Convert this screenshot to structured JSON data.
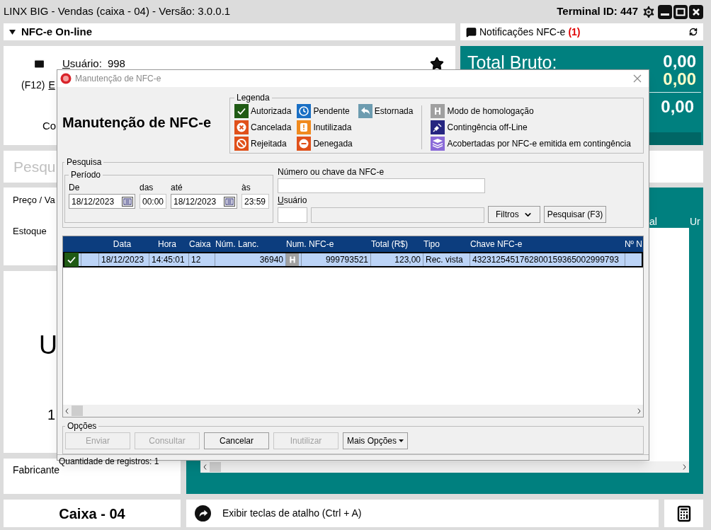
{
  "window": {
    "title": "LINX BIG - Vendas (caixa - 04) - Versão: 3.0.0.1",
    "terminal": "Terminal ID: 447"
  },
  "nfce_panel": {
    "title": "NFC-e On-line",
    "expanded": true,
    "user_label": "Usuário:",
    "user_value": "998",
    "shortcut": "(F12)",
    "link": "E",
    "text_3": "Co"
  },
  "notifications": {
    "label": "Notificações NFC-e",
    "count": "(1)"
  },
  "totals": {
    "label": "Total Bruto:",
    "values": [
      {
        "kind": "gross",
        "value": "0,00"
      },
      {
        "kind": "discount",
        "value": "0,00"
      },
      {
        "kind": "net",
        "value": "0,00"
      }
    ]
  },
  "search": {
    "placeholder": "Pesqu"
  },
  "product_fields": [
    "Preço / Va",
    "Estoque"
  ],
  "product_display": {
    "unit": "U",
    "quantity": "1"
  },
  "manufacturer": "Fabricante",
  "items_table": {
    "columns": [
      "al",
      "Ur"
    ]
  },
  "footer": {
    "register": "Caixa - 04",
    "shortcut": "Exibir teclas de atalho (Ctrl + A)"
  },
  "dialog": {
    "title": "Manutenção de NFC-e",
    "heading": "Manutenção de NFC-e",
    "legend": {
      "title": "Legenda",
      "status_columns": [
        [
          {
            "kind": "authorized",
            "label": "Autorizada"
          },
          {
            "kind": "cancelled",
            "label": "Cancelada"
          },
          {
            "kind": "rejected",
            "label": "Rejeitada"
          }
        ],
        [
          {
            "kind": "pending",
            "label": "Pendente"
          },
          {
            "kind": "voided",
            "label": "Inutilizada"
          },
          {
            "kind": "denied",
            "label": "Denegada"
          }
        ],
        [
          {
            "kind": "reversed",
            "label": "Estornada"
          }
        ]
      ],
      "mode_items": [
        {
          "kind": "homologation",
          "label": "Modo de homologação"
        },
        {
          "kind": "offline",
          "label": "Contingência off-Line"
        },
        {
          "kind": "covered",
          "label": "Acobertadas por NFC-e emitida em contingência"
        }
      ]
    },
    "search": {
      "title": "Pesquisa",
      "period": {
        "title": "Período",
        "from_label": "De",
        "from_date": "18/12/2023",
        "from_time_label": "das",
        "from_time": "00:00",
        "to_label": "até",
        "to_date": "18/12/2023",
        "to_time_label": "às",
        "to_time": "23:59"
      },
      "number_label": "Número ou chave da NFC-e",
      "user_label": "Usuário",
      "filters_button": "Filtros",
      "search_button": "Pesquisar (F3)"
    },
    "grid": {
      "columns": [
        "Data",
        "Hora",
        "Caixa",
        "Núm. Lanc.",
        "Num. NFC-e",
        "Total (R$)",
        "Tipo",
        "Chave NFC-e",
        "Nº N"
      ],
      "rows": [
        {
          "selected": true,
          "status": {
            "kind": "authorized"
          },
          "mode": {
            "kind": "homologation"
          },
          "cells": [
            "18/12/2023",
            "14:45:01",
            "12",
            "36940",
            "999793521",
            "123,00",
            "Rec. vista",
            "4323125451762800159365002999793"
          ]
        }
      ]
    },
    "options": {
      "title": "Opções",
      "buttons": [
        {
          "label": "Enviar",
          "disabled": true,
          "kind": "plain"
        },
        {
          "label": "Consultar",
          "disabled": true,
          "kind": "plain"
        },
        {
          "label": "Cancelar",
          "disabled": false,
          "kind": "plain"
        },
        {
          "label": "Inutilizar",
          "disabled": true,
          "kind": "plain"
        },
        {
          "label": "Mais Opções",
          "disabled": false,
          "kind": "menu"
        }
      ]
    },
    "status_bar": "Quantidade de registros: 1"
  }
}
